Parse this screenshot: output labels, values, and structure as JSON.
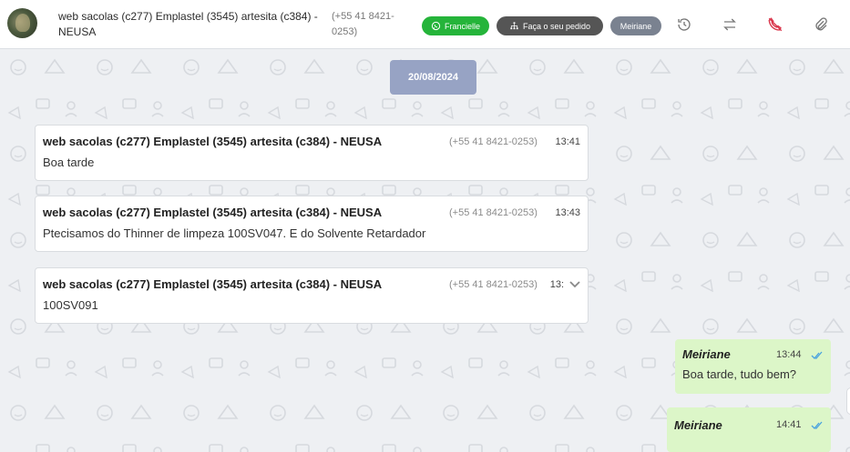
{
  "header": {
    "contact_title": "web sacolas (c277) Emplastel (3545) artesita (c384) - NEUSA",
    "contact_phone": "(+55 41 8421-0253)",
    "tags": [
      {
        "label": "Francielle",
        "icon": "whatsapp-icon",
        "color": "#25b43a"
      },
      {
        "label": "Faça o seu pedido",
        "icon": "sitemap-icon",
        "color": "#555555"
      },
      {
        "label": "Meiriane",
        "icon": "",
        "color": "#7a8290"
      }
    ],
    "actions": [
      {
        "name": "history-icon"
      },
      {
        "name": "transfer-arrows-icon"
      },
      {
        "name": "hang-up-phone-icon",
        "color": "#d9344a"
      },
      {
        "name": "paperclip-icon"
      }
    ]
  },
  "chat": {
    "date_chip": "20/08/2024",
    "incoming": [
      {
        "sender": "web sacolas (c277) Emplastel (3545) artesita (c384) - NEUSA",
        "phone": "(+55 41 8421-0253)",
        "time": "13:41",
        "text": "Boa tarde"
      },
      {
        "sender": "web sacolas (c277) Emplastel (3545) artesita (c384) - NEUSA",
        "phone": "(+55 41 8421-0253)",
        "time": "13:43",
        "text": "Ptecisamos do Thinner de limpeza 100SV047. E do Solvente Retardador"
      },
      {
        "sender": "web sacolas (c277) Emplastel (3545) artesita (c384) - NEUSA",
        "phone": "(+55 41 8421-0253)",
        "time": "13:",
        "text": "100SV091"
      }
    ],
    "outgoing": [
      {
        "sender": "Meiriane",
        "time": "13:44",
        "text": "Boa tarde, tudo bem?"
      },
      {
        "sender": "Meiriane",
        "time": "14:41",
        "text": ""
      }
    ],
    "colors": {
      "outgoing_bg": "#dcf6c8",
      "date_chip_bg": "#97a3c4",
      "read_ticks": "#4aa3df"
    }
  }
}
